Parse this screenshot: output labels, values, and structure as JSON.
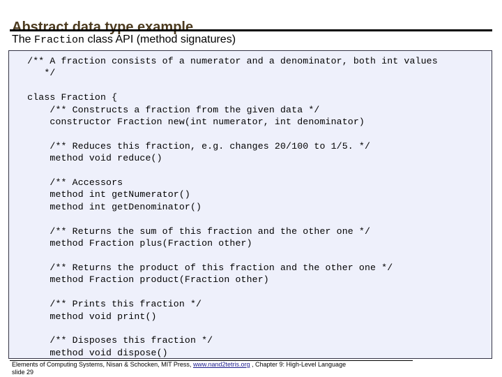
{
  "slide": {
    "title": "Abstract data type example",
    "subtitle": {
      "before": "The ",
      "mono": "Fraction",
      "after": " class API (method signatures)"
    },
    "code": "  /** A fraction consists of a numerator and a denominator, both int values\n     */\n\n  class Fraction {\n      /** Constructs a fraction from the given data */\n      constructor Fraction new(int numerator, int denominator)\n\n      /** Reduces this fraction, e.g. changes 20/100 to 1/5. */\n      method void reduce()\n\n      /** Accessors\n      method int getNumerator()\n      method int getDenominator()\n\n      /** Returns the sum of this fraction and the other one */\n      method Fraction plus(Fraction other)\n\n      /** Returns the product of this fraction and the other one */\n      method Fraction product(Fraction other)\n\n      /** Prints this fraction */\n      method void print()\n\n      /** Disposes this fraction */\n      method void dispose()",
    "footer": {
      "text_before_link": "Elements of Computing Systems, Nisan & Schocken, MIT Press, ",
      "link": "www.nand2tetris.org",
      "text_after_link": " , Chapter 9: High-Level Language",
      "slide_number": "slide 29"
    },
    "colors": {
      "title": "#4d3b1f",
      "code_background": "#eef0fb",
      "code_border": "#333344",
      "link": "#1a1a8c"
    }
  }
}
